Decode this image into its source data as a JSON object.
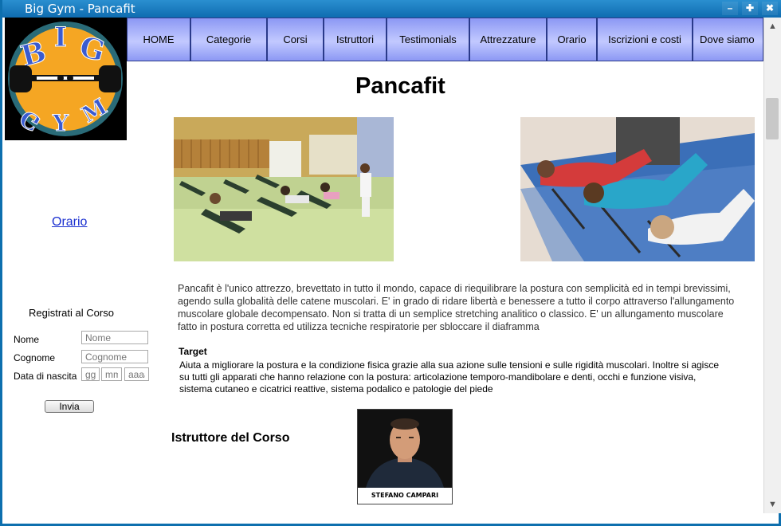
{
  "window": {
    "title": "Big Gym - Pancafit"
  },
  "logo": {
    "text_top": "BIG",
    "text_bottom": "GYM",
    "colors": {
      "ring": "#2a6b78",
      "fill": "#f5a623",
      "letters": "#3a5bd0"
    }
  },
  "nav": {
    "items": [
      {
        "label": "HOME"
      },
      {
        "label": "Categorie"
      },
      {
        "label": "Corsi"
      },
      {
        "label": "Istruttori"
      },
      {
        "label": "Testimonials"
      },
      {
        "label": "Attrezzature"
      },
      {
        "label": "Orario"
      },
      {
        "label": "Iscrizioni e costi"
      },
      {
        "label": "Dove siamo"
      }
    ]
  },
  "sidebar": {
    "orario_link": "Orario",
    "registration": {
      "title": "Registrati al Corso",
      "nome_label": "Nome",
      "nome_placeholder": "Nome",
      "cognome_label": "Cognome",
      "cognome_placeholder": "Cognome",
      "nascita_label": "Data di nascita",
      "gg_placeholder": "gg",
      "mm_placeholder": "mm",
      "aaaa_placeholder": "aaaa",
      "submit_label": "Invia"
    }
  },
  "main": {
    "title": "Pancafit",
    "description": "Pancafit è l'unico attrezzo, brevettato in tutto il mondo, capace di riequilibrare la postura con semplicità ed in tempi brevissimi, agendo sulla globalità delle catene muscolari. E' in grado di ridare libertà e benessere a tutto il corpo attraverso l'allungamento muscolare globale decompensato. Non si tratta di un semplice stretching analitico o classico. E' un allungamento muscolare fatto in postura corretta ed utilizza tecniche respiratorie per sbloccare il diaframma",
    "target_label": "Target",
    "target_text": "Aiuta a migliorare la postura e la condizione fisica grazie alla sua azione sulle tensioni e sulle rigidità muscolari. Inoltre si agisce su tutti gli apparati che hanno relazione con la postura: articolazione temporo-mandibolare e denti, occhi e funzione visiva, sistema cutaneo e cicatrici reattive, sistema podalico e patologie del piede",
    "instructor_label": "Istruttore del Corso",
    "instructor_name": "STEFANO CAMPARI"
  },
  "colors": {
    "titlebar": "#1a7cc0",
    "nav_fill": "#a6afff",
    "link": "#1a2fd0"
  },
  "icons": {
    "minimize": "minimize-icon",
    "maximize": "maximize-icon",
    "close": "close-icon",
    "scroll_up": "scroll-up-icon",
    "scroll_down": "scroll-down-icon"
  }
}
